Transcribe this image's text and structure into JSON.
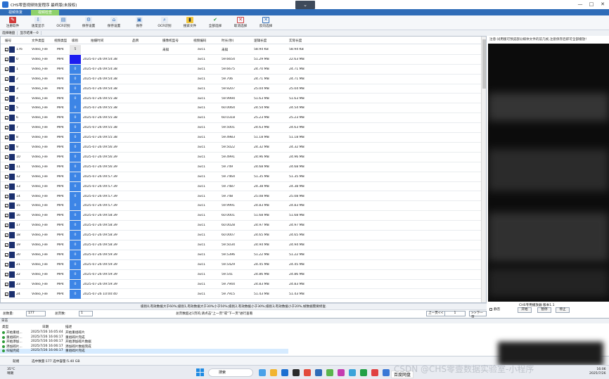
{
  "app": {
    "title": "CHS零壹视频恢复程序 最终版(未授权)",
    "collapse_icon": "chevron-down-icon",
    "min": "—",
    "max": "□",
    "close": "✕"
  },
  "tabs": [
    {
      "label": "视频恢复"
    },
    {
      "label": "视频检查"
    }
  ],
  "ribbon": [
    {
      "label": "注册软件",
      "icon": "register-icon"
    },
    {
      "label": "OCR识别",
      "icon": "ocr-icon"
    },
    {
      "label": "保存设置",
      "icon": "save-settings-icon"
    },
    {
      "label": "保存设置",
      "icon": "save-settings-icon"
    },
    {
      "label": "保存",
      "icon": "save-icon"
    },
    {
      "label": "OCR识别",
      "icon": "ocr-icon"
    },
    {
      "label": "搜索文件",
      "icon": "search-file-icon"
    },
    {
      "label": "全部选择",
      "icon": "select-all-icon"
    },
    {
      "label": "取消选择",
      "icon": "deselect-icon"
    },
    {
      "label": "反向选择",
      "icon": "invert-select-icon"
    }
  ],
  "ribbon_small": {
    "a": "速度显示"
  },
  "filter": {
    "tab1": "选择磁盘",
    "tab2": "显示结果---0"
  },
  "columns": [
    "编号",
    "文件类型",
    "视频类型",
    "级别",
    "拍摄时间",
    "品牌",
    "摄像机型号",
    "视频编码",
    "时长(秒)",
    "逻辑长度",
    "实际长度"
  ],
  "rows": [
    {
      "id": "176",
      "type": "Video_File",
      "vtype": "MP4",
      "lvl": "5",
      "time": "",
      "brand": "",
      "model": "未知",
      "codec": "avc1",
      "dur": "未知",
      "logic": "58.94 KB",
      "real": "58.94 KB"
    },
    {
      "id": "0",
      "type": "Video_File",
      "vtype": "MP4",
      "lvl": "",
      "time": "2025-07-26 09:54:38",
      "brand": "",
      "model": "",
      "codec": "avc1",
      "dur": "59.6654",
      "logic": "51.29 MB",
      "real": "22.63 MB"
    },
    {
      "id": "1",
      "type": "Video_File",
      "vtype": "MP4",
      "lvl": "0",
      "time": "2025-07-26 09:54:38",
      "brand": "",
      "model": "",
      "codec": "avc1",
      "dur": "59.6675",
      "logic": "24.70 MB",
      "real": "24.71 MB"
    },
    {
      "id": "2",
      "type": "Video_File",
      "vtype": "MP4",
      "lvl": "0",
      "time": "2025-07-26 09:54:38",
      "brand": "",
      "model": "",
      "codec": "avc1",
      "dur": "59.706",
      "logic": "24.71 MB",
      "real": "24.71 MB"
    },
    {
      "id": "3",
      "type": "Video_File",
      "vtype": "MP4",
      "lvl": "0",
      "time": "2025-07-26 09:54:38",
      "brand": "",
      "model": "",
      "codec": "avc1",
      "dur": "59.9207",
      "logic": "25.04 MB",
      "real": "25.04 MB"
    },
    {
      "id": "4",
      "type": "Video_File",
      "vtype": "MP4",
      "lvl": "0",
      "time": "2025-07-26 09:55:38",
      "brand": "",
      "model": "",
      "codec": "avc1",
      "dur": "59.9994",
      "logic": "51.63 MB",
      "real": "51.63 MB"
    },
    {
      "id": "5",
      "type": "Video_File",
      "vtype": "MP4",
      "lvl": "0",
      "time": "2025-07-26 09:55:38",
      "brand": "",
      "model": "",
      "codec": "avc1",
      "dur": "60.0064",
      "logic": "24.54 MB",
      "real": "24.54 MB"
    },
    {
      "id": "6",
      "type": "Video_File",
      "vtype": "MP4",
      "lvl": "0",
      "time": "2025-07-26 09:55:38",
      "brand": "",
      "model": "",
      "codec": "avc1",
      "dur": "60.0318",
      "logic": "25.23 MB",
      "real": "25.23 MB"
    },
    {
      "id": "7",
      "type": "Video_File",
      "vtype": "MP4",
      "lvl": "0",
      "time": "2025-07-26 09:55:38",
      "brand": "",
      "model": "",
      "codec": "avc1",
      "dur": "59.5001",
      "logic": "24.63 MB",
      "real": "24.63 MB"
    },
    {
      "id": "8",
      "type": "Video_File",
      "vtype": "MP4",
      "lvl": "0",
      "time": "2025-07-26 09:55:38",
      "brand": "",
      "model": "",
      "codec": "avc1",
      "dur": "59.4983",
      "logic": "51.18 MB",
      "real": "51.18 MB"
    },
    {
      "id": "9",
      "type": "Video_File",
      "vtype": "MP4",
      "lvl": "0",
      "time": "2025-07-26 09:56:39",
      "brand": "",
      "model": "",
      "codec": "avc1",
      "dur": "59.5022",
      "logic": "24.32 MB",
      "real": "24.32 MB"
    },
    {
      "id": "10",
      "type": "Video_File",
      "vtype": "MP4",
      "lvl": "0",
      "time": "2025-07-26 09:56:39",
      "brand": "",
      "model": "",
      "codec": "avc1",
      "dur": "59.4991",
      "logic": "24.96 MB",
      "real": "24.96 MB"
    },
    {
      "id": "11",
      "type": "Video_File",
      "vtype": "MP4",
      "lvl": "0",
      "time": "2025-07-26 09:56:39",
      "brand": "",
      "model": "",
      "codec": "avc1",
      "dur": "59.749",
      "logic": "24.68 MB",
      "real": "24.68 MB"
    },
    {
      "id": "12",
      "type": "Video_File",
      "vtype": "MP4",
      "lvl": "0",
      "time": "2025-07-26 09:57:39",
      "brand": "",
      "model": "",
      "codec": "avc1",
      "dur": "59.7464",
      "logic": "51.35 MB",
      "real": "51.35 MB"
    },
    {
      "id": "13",
      "type": "Video_File",
      "vtype": "MP4",
      "lvl": "0",
      "time": "2025-07-26 09:57:39",
      "brand": "",
      "model": "",
      "codec": "avc1",
      "dur": "59.7487",
      "logic": "24.38 MB",
      "real": "24.38 MB"
    },
    {
      "id": "14",
      "type": "Video_File",
      "vtype": "MP4",
      "lvl": "0",
      "time": "2025-07-26 09:57:39",
      "brand": "",
      "model": "",
      "codec": "avc1",
      "dur": "59.748",
      "logic": "25.08 MB",
      "real": "25.08 MB"
    },
    {
      "id": "15",
      "type": "Video_File",
      "vtype": "MP4",
      "lvl": "0",
      "time": "2025-07-26 09:57:39",
      "brand": "",
      "model": "",
      "codec": "avc1",
      "dur": "59.9991",
      "logic": "24.83 MB",
      "real": "24.83 MB"
    },
    {
      "id": "16",
      "type": "Video_File",
      "vtype": "MP4",
      "lvl": "0",
      "time": "2025-07-26 09:58:39",
      "brand": "",
      "model": "",
      "codec": "avc1",
      "dur": "60.0001",
      "logic": "51.68 MB",
      "real": "51.68 MB"
    },
    {
      "id": "17",
      "type": "Video_File",
      "vtype": "MP4",
      "lvl": "0",
      "time": "2025-07-26 09:58:39",
      "brand": "",
      "model": "",
      "codec": "avc1",
      "dur": "60.0028",
      "logic": "24.97 MB",
      "real": "24.97 MB"
    },
    {
      "id": "18",
      "type": "Video_File",
      "vtype": "MP4",
      "lvl": "0",
      "time": "2025-07-26 09:58:39",
      "brand": "",
      "model": "",
      "codec": "avc1",
      "dur": "60.0007",
      "logic": "24.65 MB",
      "real": "24.65 MB"
    },
    {
      "id": "19",
      "type": "Video_File",
      "vtype": "MP4",
      "lvl": "0",
      "time": "2025-07-26 09:58:39",
      "brand": "",
      "model": "",
      "codec": "avc1",
      "dur": "59.5034",
      "logic": "24.94 MB",
      "real": "24.94 MB"
    },
    {
      "id": "20",
      "type": "Video_File",
      "vtype": "MP4",
      "lvl": "0",
      "time": "2025-07-26 09:59:39",
      "brand": "",
      "model": "",
      "codec": "avc1",
      "dur": "59.5396",
      "logic": "51.22 MB",
      "real": "51.22 MB"
    },
    {
      "id": "21",
      "type": "Video_File",
      "vtype": "MP4",
      "lvl": "0",
      "time": "2025-07-26 09:59:39",
      "brand": "",
      "model": "",
      "codec": "avc1",
      "dur": "59.5429",
      "logic": "24.45 MB",
      "real": "24.45 MB"
    },
    {
      "id": "22",
      "type": "Video_File",
      "vtype": "MP4",
      "lvl": "0",
      "time": "2025-07-26 09:59:39",
      "brand": "",
      "model": "",
      "codec": "avc1",
      "dur": "59.541",
      "logic": "24.86 MB",
      "real": "24.86 MB"
    },
    {
      "id": "23",
      "type": "Video_File",
      "vtype": "MP4",
      "lvl": "0",
      "time": "2025-07-26 09:59:39",
      "brand": "",
      "model": "",
      "codec": "avc1",
      "dur": "59.7944",
      "logic": "24.83 MB",
      "real": "24.83 MB"
    },
    {
      "id": "24",
      "type": "Video_File",
      "vtype": "MP4",
      "lvl": "0",
      "time": "2025-07-26 10:00:40",
      "brand": "",
      "model": "",
      "codec": "avc1",
      "dur": "59.7915",
      "logic": "51.43 MB",
      "real": "51.43 MB"
    }
  ],
  "hint": "级别0,有效数据大于60%;级别1,有效数据大于30%小于50%;级别2,有效数据小于30%;级别3,有效数据小于20%,帧数据需要修复.",
  "pager": {
    "total_label": "总数量:",
    "total": "177",
    "pages_label": "总页数:",
    "pages": "1",
    "msg": "总页数超过1页的,请点击\"上一页\"或\"下一页\"进行查看",
    "prev": "上一页<<",
    "page": "1",
    ">>next": "",
    "next": ">>下一页"
  },
  "right": {
    "note": "注意:试用版可预览部分媒体文件的前几帧,注意保存后即可全部播放!",
    "player_label": "CHS专用播放器 版本1.1",
    "loop": "静音",
    "start": "开始",
    "pause": "暂停",
    "stop": "停止"
  },
  "log": {
    "header": "日志",
    "cols": [
      "类型",
      "日期",
      "描述"
    ],
    "rows": [
      {
        "type": "开始重组...",
        "date": "2025/7/26 16:05:44",
        "desc": "开始重组碎片"
      },
      {
        "type": "重组碎片...",
        "date": "2025/7/26 16:06:17",
        "desc": "重组碎片完成"
      },
      {
        "type": "开始添加...",
        "date": "2025/7/26 16:06:17",
        "desc": "开始添加碎片数据"
      },
      {
        "type": "添加碎片...",
        "date": "2025/7/26 16:06:17",
        "desc": "添加碎片数据完成"
      },
      {
        "type": "扫描完成",
        "date": "2025/7/26 16:06:17",
        "desc": "重组碎片完成"
      }
    ]
  },
  "status": {
    "ready": "就绪",
    "selected": "选中数量:177 选中容量:5.40 GB"
  },
  "taskbar": {
    "temp": "35°C",
    "weather": "晴朗",
    "search": "搜索",
    "watermark": "CSDN @CHS零壹数据实验室-小程序",
    "baidu": "百度网盘",
    "time": "16:06",
    "date": "2025/7/26"
  },
  "colors": {
    "accent": "#2f6cb8",
    "tab_active": "#8fd16a",
    "level_cell": "#3d85e6",
    "ok": "#2e9b3a"
  }
}
